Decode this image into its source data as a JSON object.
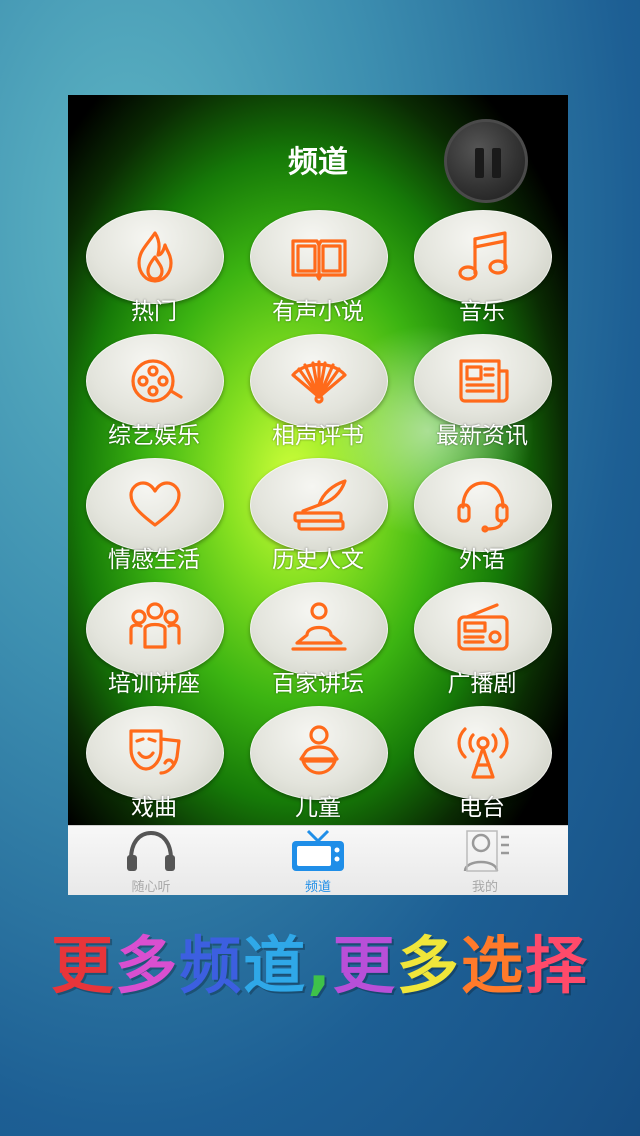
{
  "header": {
    "title": "频道"
  },
  "channels": [
    {
      "label": "热门",
      "icon": "fire-icon"
    },
    {
      "label": "有声小说",
      "icon": "book-icon"
    },
    {
      "label": "音乐",
      "icon": "music-note-icon"
    },
    {
      "label": "综艺娱乐",
      "icon": "film-reel-icon"
    },
    {
      "label": "相声评书",
      "icon": "fan-icon"
    },
    {
      "label": "最新资讯",
      "icon": "newspaper-icon"
    },
    {
      "label": "情感生活",
      "icon": "heart-icon"
    },
    {
      "label": "历史人文",
      "icon": "quill-books-icon"
    },
    {
      "label": "外语",
      "icon": "headset-icon"
    },
    {
      "label": "培训讲座",
      "icon": "group-icon"
    },
    {
      "label": "百家讲坛",
      "icon": "lecturer-icon"
    },
    {
      "label": "广播剧",
      "icon": "radio-icon"
    },
    {
      "label": "戏曲",
      "icon": "opera-mask-icon"
    },
    {
      "label": "儿童",
      "icon": "baby-icon"
    },
    {
      "label": "电台",
      "icon": "broadcast-tower-icon"
    }
  ],
  "tabbar": {
    "tabs": [
      {
        "label": "随心听",
        "icon": "headphones-icon",
        "active": false
      },
      {
        "label": "频道",
        "icon": "tv-icon",
        "active": true
      },
      {
        "label": "我的",
        "icon": "profile-icon",
        "active": false
      }
    ]
  },
  "slogan": {
    "text": "更多频道,更多选择",
    "colors": [
      "#e8353a",
      "#d94fd0",
      "#3c5fe0",
      "#2fa8e8",
      "#3ec24a",
      "#b84fd8",
      "#f0e63a",
      "#ff7a2a",
      "#ff4a6a"
    ]
  },
  "accent_color": "#ff6a1a",
  "active_tab_color": "#1f8ee8"
}
